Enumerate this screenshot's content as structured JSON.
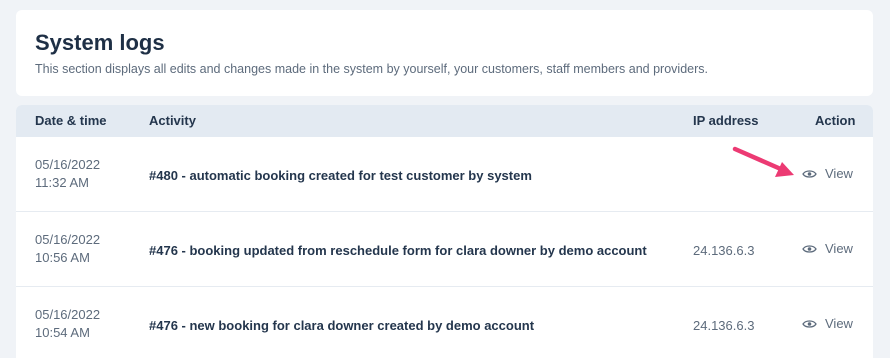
{
  "header": {
    "title": "System logs",
    "description": "This section displays all edits and changes made in the system by yourself, your customers, staff members and providers."
  },
  "table": {
    "columns": {
      "date": "Date & time",
      "activity": "Activity",
      "ip": "IP address",
      "action": "Action"
    },
    "rows": [
      {
        "date": "05/16/2022",
        "time": "11:32 AM",
        "activity": "#480 - automatic booking created for test customer by system",
        "ip": "",
        "action": "View"
      },
      {
        "date": "05/16/2022",
        "time": "10:56 AM",
        "activity": "#476 - booking updated from reschedule form for clara downer by demo account",
        "ip": "24.136.6.3",
        "action": "View"
      },
      {
        "date": "05/16/2022",
        "time": "10:54 AM",
        "activity": "#476 - new booking for clara downer created by demo account",
        "ip": "24.136.6.3",
        "action": "View"
      }
    ]
  },
  "colors": {
    "accent_arrow": "#ec3a73",
    "header_bg": "#e3eaf2",
    "page_bg": "#f0f3f7"
  },
  "icons": {
    "view": "eye-icon",
    "annotation": "arrow-icon"
  }
}
